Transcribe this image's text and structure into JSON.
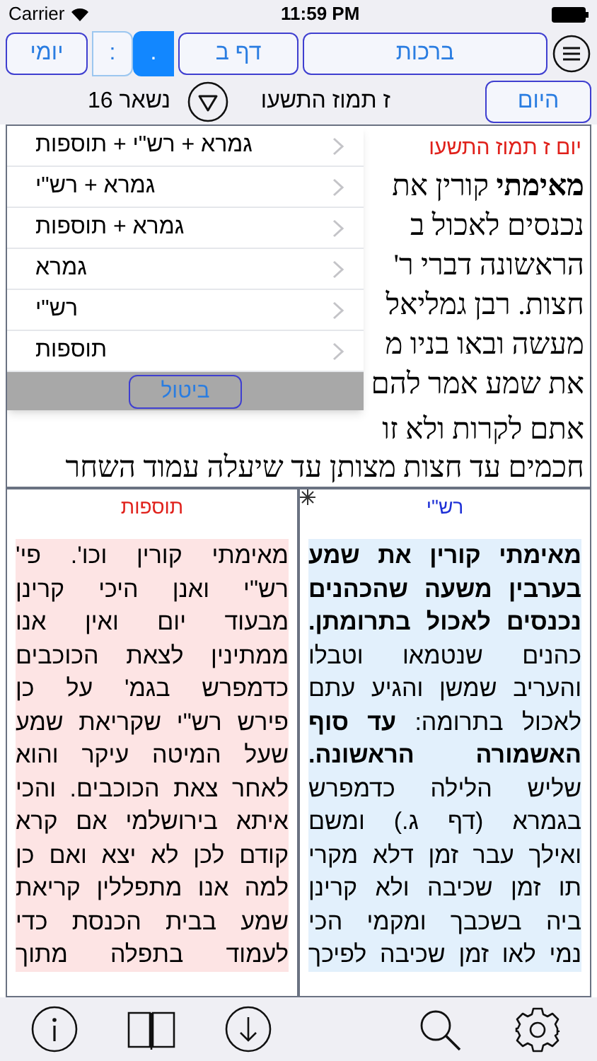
{
  "status_bar": {
    "carrier": "Carrier",
    "time": "11:59 PM"
  },
  "top_bar": {
    "yomi_button": "יומי",
    "segments": [
      {
        "label": ".",
        "selected": true
      },
      {
        "label": ":",
        "selected": false
      }
    ],
    "daf_button": "דף ב",
    "tractate_button": "ברכות"
  },
  "date_bar": {
    "remaining": "נשאר 16",
    "date": "ז תמוז התשעו",
    "today_button": "היום"
  },
  "gemara": {
    "heading": "יום ז תמוז התשעו",
    "lines_beside_menu": [
      "**מאימתי** קורין את",
      "נכנסים לאכול ב",
      "הראשונה דברי ר'",
      "חצות. רבן גמליאל",
      "מעשה ובאו בניו מ",
      "את שמע אמר להם"
    ],
    "lines_below_menu": [
      "אתם לקרות ולא זו",
      "חכמים עד חצות מצותן עד שיעלה עמוד השחר"
    ]
  },
  "menu": {
    "items": [
      "גמרא + רש\"י + תוספות",
      "גמרא + רש\"י",
      "גמרא + תוספות",
      "גמרא",
      "רש\"י",
      "תוספות"
    ],
    "cancel_button": "ביטול"
  },
  "commentaries": [
    {
      "kind": "rashi",
      "title": "רש\"י",
      "lines": [
        "**מאימתי קורין את שמע**",
        "**בערבין משעה שהכהנים**",
        "**נכנסים לאכול בתרומתן.**",
        "כהנים שנטמאו וטבלו",
        "והעריב שמשן והגיע עתם",
        "לאכול בתרומה: **עד סוף**",
        "**האשמורה הראשונה.**",
        "שליש הלילה כדמפרש",
        "בגמרא (דף ג.) ומשם",
        "ואילך עבר זמן דלא מקרי",
        "תו זמן שכיבה ולא קרינן",
        "ביה בשכבך ומקמי הכי",
        "נמי לאו זמן שכיבה לפיכך"
      ]
    },
    {
      "kind": "tosafot",
      "title": "תוספות",
      "lines": [
        "מאימתי קורין וכו'. פי'",
        "רש\"י ואנן היכי קרינן",
        "מבעוד יום ואין אנו",
        "ממתינין לצאת הכוכבים",
        "כדמפרש בגמ' על כן",
        "פירש רש\"י שקריאת שמע",
        "שעל המיטה עיקר והוא",
        "לאחר צאת הכוכבים. והכי",
        "איתא בירושלמי אם קרא",
        "קודם לכן לא יצא ואם כן",
        "למה אנו מתפללין קריאת",
        "שמע בבית הכנסת כדי",
        "לעמוד בתפלה מתוך"
      ]
    }
  ]
}
